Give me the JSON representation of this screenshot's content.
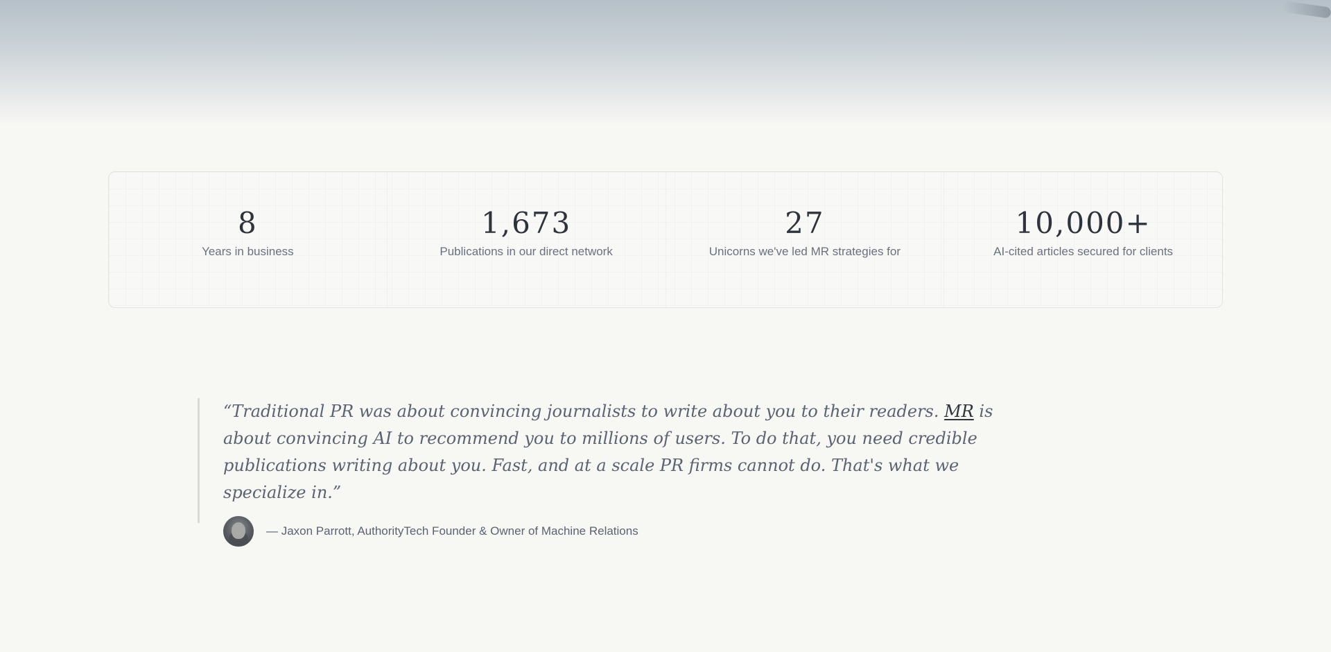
{
  "stats": [
    {
      "value": "8",
      "label": "Years in business"
    },
    {
      "value": "1,673",
      "label": "Publications in our direct network"
    },
    {
      "value": "27",
      "label": "Unicorns we've led MR strategies for"
    },
    {
      "value": "10,000+",
      "label": "AI-cited articles secured for clients"
    }
  ],
  "quote": {
    "before": "“Traditional PR was about convincing journalists to write about you to their readers. ",
    "abbr": "MR",
    "after": " is about convincing AI to recommend you to millions of users. To do that, you need credible publications writing about you. Fast, and at a scale PR firms cannot do. That's what we specialize in.”",
    "attribution": "— Jaxon Parrott, AuthorityTech Founder & Owner of Machine Relations"
  },
  "colors": {
    "background": "#f7f7f4",
    "stat_value": "#2f343c",
    "muted_text": "#6a7080"
  }
}
